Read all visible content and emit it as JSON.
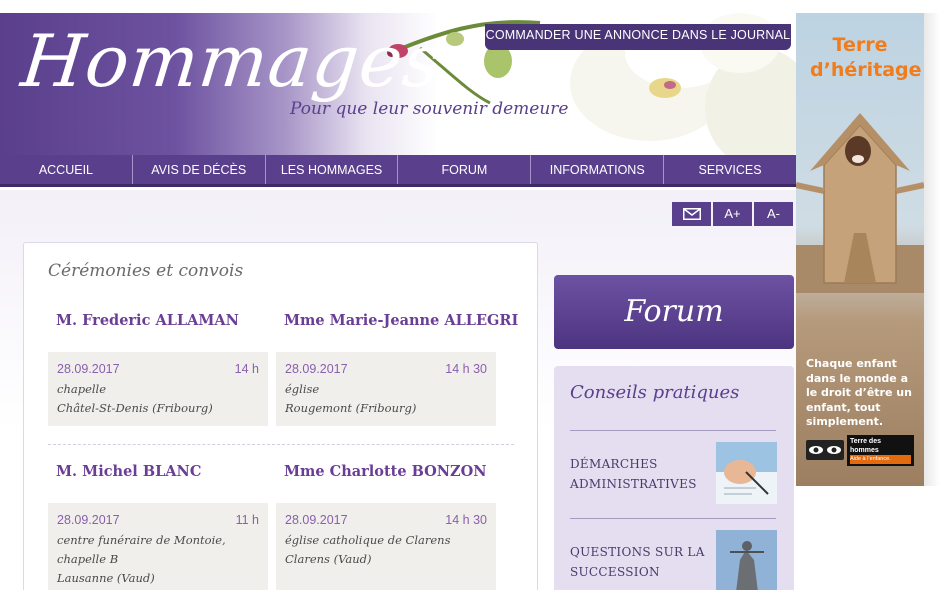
{
  "header": {
    "logo": "Hommages",
    "tagline": "Pour que leur souvenir demeure",
    "order_button": "COMMANDER UNE ANNONCE DANS LE JOURNAL"
  },
  "nav": {
    "items": [
      "ACCUEIL",
      "AVIS DE DÉCÈS",
      "LES HOMMAGES",
      "FORUM",
      "INFORMATIONS",
      "SERVICES"
    ]
  },
  "tools": {
    "mail_icon": "envelope-icon",
    "increase": "A+",
    "decrease": "A-"
  },
  "ceremonies": {
    "title": "Cérémonies et convois",
    "cards": [
      {
        "name": "M. Frederic ALLAMAN",
        "date": "28.09.2017",
        "time": "14 h",
        "place_type": "chapelle",
        "location": "Châtel-St-Denis (Fribourg)"
      },
      {
        "name": "Mme Marie-Jeanne ALLEGRI",
        "date": "28.09.2017",
        "time": "14 h 30",
        "place_type": "église",
        "location": "Rougemont (Fribourg)"
      },
      {
        "name": "M. Michel BLANC",
        "date": "28.09.2017",
        "time": "11 h",
        "place_type": "centre funéraire de Montoie, chapelle B",
        "location": "Lausanne (Vaud)"
      },
      {
        "name": "Mme Charlotte BONZON",
        "date": "28.09.2017",
        "time": "14 h 30",
        "place_type": "église catholique de Clarens",
        "location": "Clarens (Vaud)"
      }
    ]
  },
  "forum": {
    "label": "Forum"
  },
  "conseils": {
    "title": "Conseils pratiques",
    "items": [
      {
        "label": "DÉMARCHES ADMINISTRATIVES",
        "icon": "writing-hand-photo"
      },
      {
        "label": "QUESTIONS SUR LA SUCCESSION",
        "icon": "justice-statue-photo"
      }
    ]
  },
  "ad": {
    "title": "Terre d’héritage",
    "text": "Chaque enfant dans le monde a le droit d’être un enfant, tout simplement.",
    "logo_name": "Terre des hommes",
    "logo_tagline": "Aide à l’enfance."
  },
  "colors": {
    "brand_purple": "#5a3f8c",
    "name_purple": "#6a3e96",
    "date_purple": "#8a5fae",
    "ad_orange": "#f07c1c"
  }
}
